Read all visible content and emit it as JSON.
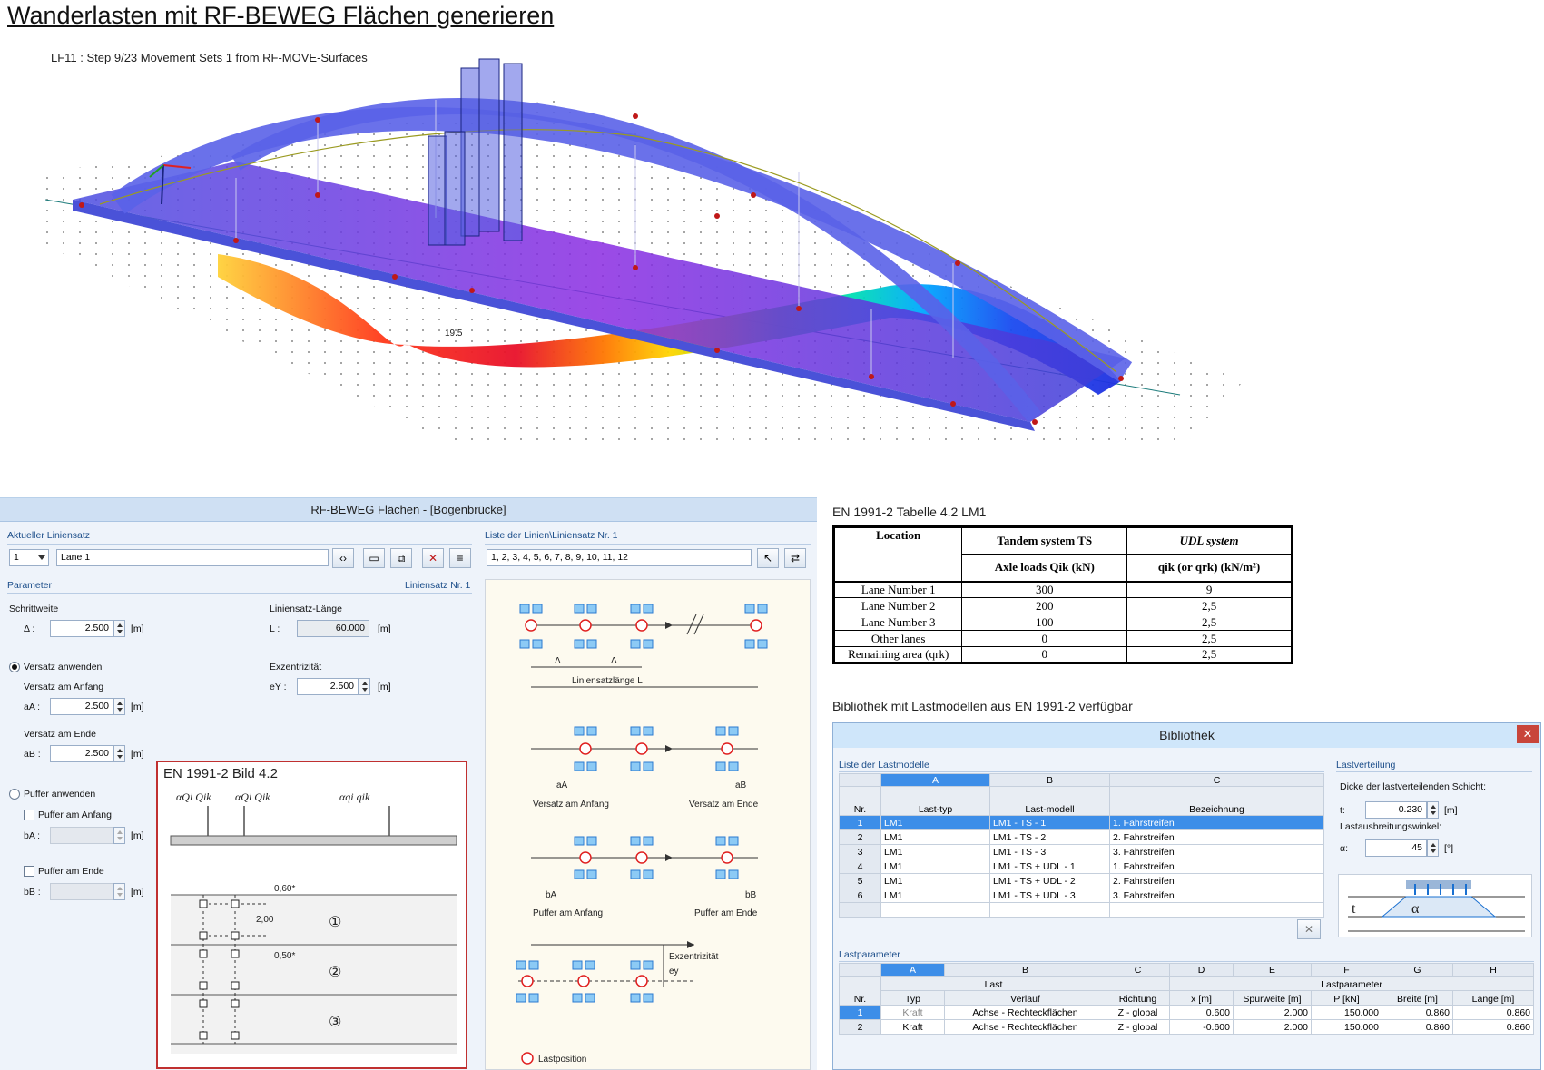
{
  "page_title": "Wanderlasten mit RF-BEWEG Flächen generieren",
  "viewport": {
    "caption": "LF11 : Step 9/23 Movement Sets 1 from RF-MOVE-Surfaces",
    "max_value_label": "19.5"
  },
  "rf_beweg": {
    "window_title": "RF-BEWEG Flächen - [Bogenbrücke]",
    "current_set": {
      "group_label": "Aktueller Liniensatz",
      "number": "1",
      "name": "Lane 1"
    },
    "line_list": {
      "group_label": "Liste der Linien\\Liniensatz Nr. 1",
      "value": "1, 2, 3, 4, 5, 6, 7, 8, 9, 10, 11, 12"
    },
    "parameters": {
      "group_label": "Parameter",
      "set_label": "Liniensatz Nr. 1",
      "step_label": "Schrittweite",
      "step_symbol": "Δ :",
      "step_value": "2.500",
      "length_label": "Liniensatz-Länge",
      "length_symbol": "L :",
      "length_value": "60.000",
      "offset_apply_label": "Versatz anwenden",
      "offset_start_label": "Versatz am Anfang",
      "offset_start_symbol": "aA :",
      "offset_start_value": "2.500",
      "offset_end_label": "Versatz am Ende",
      "offset_end_symbol": "aB :",
      "offset_end_value": "2.500",
      "eccentricity_label": "Exzentrizität",
      "eccentricity_symbol": "eY :",
      "eccentricity_value": "2.500",
      "buffer_apply_label": "Puffer anwenden",
      "buffer_start_label": "Puffer am Anfang",
      "buffer_start_symbol": "bA :",
      "buffer_end_label": "Puffer am Ende",
      "buffer_end_symbol": "bB :",
      "unit": "[m]"
    },
    "figure": {
      "title": "EN 1991-2 Bild 4.2",
      "dim_top": "0,60*",
      "dim_mid": "2,00",
      "dim_bottom": "0,50*",
      "lane_1": "①",
      "lane_2": "②",
      "lane_3": "③"
    },
    "diagram": {
      "delta": "Δ",
      "set_length": "Liniensatzlänge L",
      "offset_start": "Versatz am Anfang",
      "offset_end": "Versatz am Ende",
      "aA": "aA",
      "aB": "aB",
      "buffer_start": "Puffer am Anfang",
      "buffer_end": "Puffer am Ende",
      "bA": "bA",
      "bB": "bB",
      "eccentricity": "Exzentrizität",
      "ey": "ey",
      "load_position": "Lastposition"
    }
  },
  "lm1_table": {
    "caption": "EN 1991-2 Tabelle 4.2 LM1",
    "headers": {
      "location": "Location",
      "tandem": "Tandem system TS",
      "udl": "UDL system",
      "axle_loads": "Axle loads Qik (kN)",
      "qik": "qik (or qrk) (kN/m²)"
    },
    "rows": [
      {
        "location": "Lane Number 1",
        "axle": "300",
        "udl": "9"
      },
      {
        "location": "Lane Number 2",
        "axle": "200",
        "udl": "2,5"
      },
      {
        "location": "Lane Number 3",
        "axle": "100",
        "udl": "2,5"
      },
      {
        "location": "Other lanes",
        "axle": "0",
        "udl": "2,5"
      },
      {
        "location": "Remaining area (qrk)",
        "axle": "0",
        "udl": "2,5"
      }
    ]
  },
  "library": {
    "caption": "Bibliothek mit Lastmodellen aus EN 1991-2 verfügbar",
    "title": "Bibliothek",
    "models_label": "Liste der Lastmodelle",
    "columns": {
      "a": "A",
      "b": "B",
      "c": "C",
      "nr": "Nr.",
      "type": "Last-typ",
      "model": "Last-modell",
      "name": "Bezeichnung"
    },
    "models": [
      {
        "nr": "1",
        "type": "LM1",
        "model": "LM1 - TS - 1",
        "name": "1. Fahrstreifen"
      },
      {
        "nr": "2",
        "type": "LM1",
        "model": "LM1 - TS - 2",
        "name": "2. Fahrstreifen"
      },
      {
        "nr": "3",
        "type": "LM1",
        "model": "LM1 - TS - 3",
        "name": "3. Fahrstreifen"
      },
      {
        "nr": "4",
        "type": "LM1",
        "model": "LM1 - TS + UDL - 1",
        "name": "1. Fahrstreifen"
      },
      {
        "nr": "5",
        "type": "LM1",
        "model": "LM1 - TS + UDL - 2",
        "name": "2. Fahrstreifen"
      },
      {
        "nr": "6",
        "type": "LM1",
        "model": "LM1 - TS + UDL - 3",
        "name": "3. Fahrstreifen"
      }
    ],
    "distribution": {
      "label": "Lastverteilung",
      "thickness_label": "Dicke der lastverteilenden Schicht:",
      "thickness_symbol": "t:",
      "thickness_value": "0.230",
      "thickness_unit": "[m]",
      "angle_label": "Lastausbreitungswinkel:",
      "angle_symbol": "α:",
      "angle_value": "45",
      "angle_unit": "[°]",
      "t_letter": "t",
      "alpha_letter": "α"
    },
    "params": {
      "label": "Lastparameter",
      "cols": [
        "A",
        "B",
        "C",
        "D",
        "E",
        "F",
        "G",
        "H"
      ],
      "group_last": "Last",
      "group_params": "Lastparameter",
      "headers": [
        "Typ",
        "Verlauf",
        "Richtung",
        "x [m]",
        "Spurweite [m]",
        "P [kN]",
        "Breite [m]",
        "Länge [m]"
      ],
      "rows": [
        {
          "nr": "1",
          "typ": "Kraft",
          "verlauf": "Achse - Rechteckflächen",
          "richtung": "Z - global",
          "x": "0.600",
          "spur": "2.000",
          "p": "150.000",
          "breite": "0.860",
          "laenge": "0.860"
        },
        {
          "nr": "2",
          "typ": "Kraft",
          "verlauf": "Achse - Rechteckflächen",
          "richtung": "Z - global",
          "x": "-0.600",
          "spur": "2.000",
          "p": "150.000",
          "breite": "0.860",
          "laenge": "0.860"
        }
      ]
    }
  },
  "colors": {
    "steel_blue": "#5560e0",
    "deck_purple": "#8a2be2",
    "selection_blue": "#3d8ee8",
    "frame_red": "#c03030"
  }
}
